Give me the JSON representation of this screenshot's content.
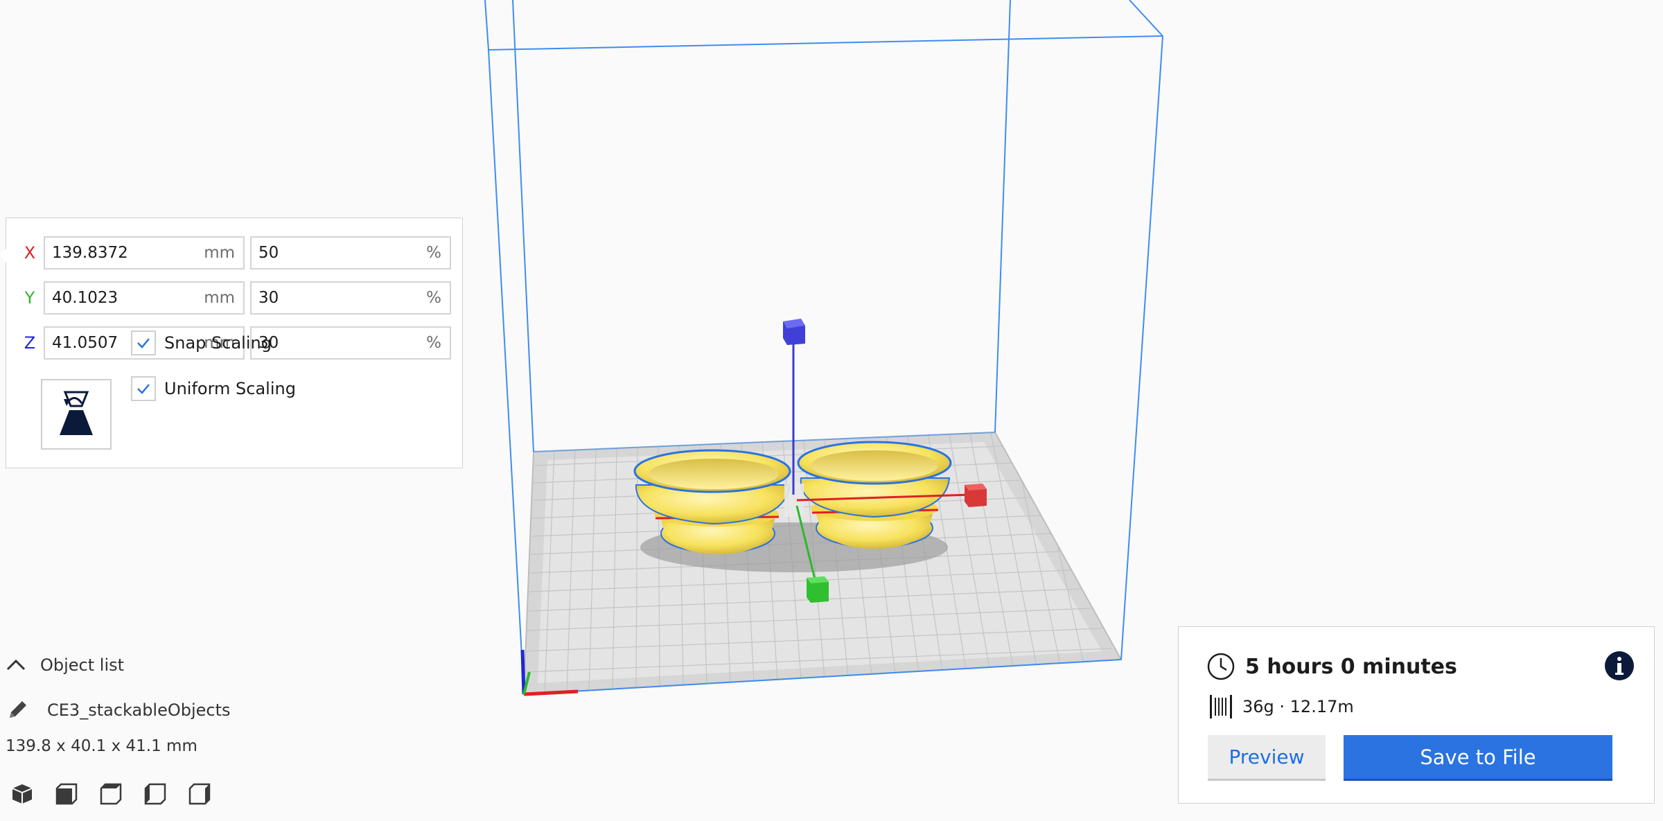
{
  "scale_tool": {
    "rows": [
      {
        "axis": "X",
        "axis_color": "#e02020",
        "mm": "139.8372",
        "pct": "50"
      },
      {
        "axis": "Y",
        "axis_color": "#2db82d",
        "mm": "40.1023",
        "pct": "30"
      },
      {
        "axis": "Z",
        "axis_color": "#2026d8",
        "mm": "41.0507",
        "pct": "30"
      }
    ],
    "unit_mm": "mm",
    "unit_pct": "%",
    "snap_scaling_label": "Snap Scaling",
    "uniform_scaling_label": "Uniform Scaling",
    "snap_scaling_checked": true,
    "uniform_scaling_checked": true
  },
  "object_list": {
    "toggle_label": "Object list",
    "object_name": "CE3_stackableObjects",
    "dimensions": "139.8 x 40.1 x 41.1 mm"
  },
  "print_info": {
    "time": "5 hours 0 minutes",
    "material": "36g · 12.17m",
    "preview_label": "Preview",
    "save_label": "Save to File"
  },
  "colors": {
    "accent": "#2a73e0",
    "model_fill": "#f7e25e",
    "build_volume": "#3f8cf0"
  },
  "icons": {
    "reset": "reset-scale-icon",
    "pencil": "pencil-icon",
    "clock": "clock-icon",
    "info": "info-icon",
    "spool": "filament-icon",
    "chevron": "chevron-up-icon"
  }
}
